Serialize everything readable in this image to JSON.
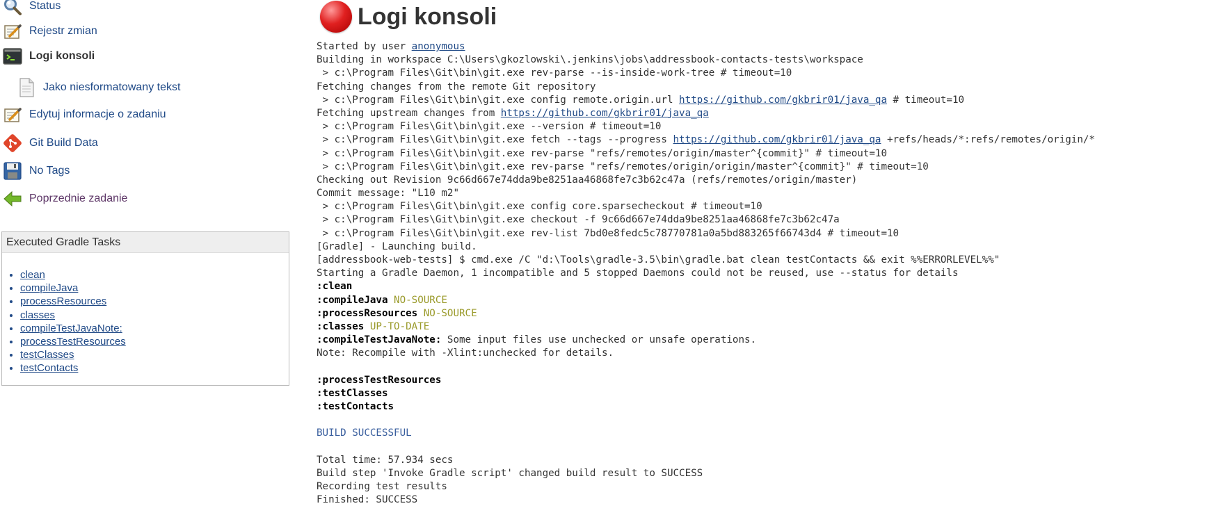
{
  "sidebar": {
    "items": [
      {
        "label": "Status",
        "icon": "magnifier-icon"
      },
      {
        "label": "Rejestr zmian",
        "icon": "notepad-icon"
      },
      {
        "label": "Logi konsoli",
        "icon": "terminal-icon"
      },
      {
        "label": "Jako niesformatowany tekst",
        "icon": "document-icon"
      },
      {
        "label": "Edytuj informacje o zadaniu",
        "icon": "notepad-icon"
      },
      {
        "label": "Git Build Data",
        "icon": "git-icon"
      },
      {
        "label": "No Tags",
        "icon": "floppy-disk-icon"
      },
      {
        "label": "Poprzednie zadanie",
        "icon": "green-arrow-left-icon"
      }
    ]
  },
  "gradle_tasks": {
    "title": "Executed Gradle Tasks",
    "items": [
      "clean",
      "compileJava",
      "processResources",
      "classes",
      "compileTestJavaNote:",
      "processTestResources",
      "testClasses",
      "testContacts"
    ]
  },
  "page": {
    "title": "Logi konsoli",
    "status_color": "#e02020"
  },
  "console": {
    "lines": [
      {
        "parts": [
          {
            "t": "Started by user "
          },
          {
            "t": "anonymous",
            "link": true
          }
        ]
      },
      {
        "parts": [
          {
            "t": "Building in workspace C:\\Users\\gkozlowski\\.jenkins\\jobs\\addressbook-contacts-tests\\workspace"
          }
        ]
      },
      {
        "parts": [
          {
            "t": " > c:\\Program Files\\Git\\bin\\git.exe rev-parse --is-inside-work-tree # timeout=10"
          }
        ]
      },
      {
        "parts": [
          {
            "t": "Fetching changes from the remote Git repository"
          }
        ]
      },
      {
        "parts": [
          {
            "t": " > c:\\Program Files\\Git\\bin\\git.exe config remote.origin.url "
          },
          {
            "t": "https://github.com/gkbrir01/java_qa",
            "link": true
          },
          {
            "t": " # timeout=10"
          }
        ]
      },
      {
        "parts": [
          {
            "t": "Fetching upstream changes from "
          },
          {
            "t": "https://github.com/gkbrir01/java_qa",
            "link": true
          }
        ]
      },
      {
        "parts": [
          {
            "t": " > c:\\Program Files\\Git\\bin\\git.exe --version # timeout=10"
          }
        ]
      },
      {
        "parts": [
          {
            "t": " > c:\\Program Files\\Git\\bin\\git.exe fetch --tags --progress "
          },
          {
            "t": "https://github.com/gkbrir01/java_qa",
            "link": true
          },
          {
            "t": " +refs/heads/*:refs/remotes/origin/*"
          }
        ]
      },
      {
        "parts": [
          {
            "t": " > c:\\Program Files\\Git\\bin\\git.exe rev-parse \"refs/remotes/origin/master^{commit}\" # timeout=10"
          }
        ]
      },
      {
        "parts": [
          {
            "t": " > c:\\Program Files\\Git\\bin\\git.exe rev-parse \"refs/remotes/origin/origin/master^{commit}\" # timeout=10"
          }
        ]
      },
      {
        "parts": [
          {
            "t": "Checking out Revision 9c66d667e74dda9be8251aa46868fe7c3b62c47a (refs/remotes/origin/master)"
          }
        ]
      },
      {
        "parts": [
          {
            "t": "Commit message: \"L10 m2\""
          }
        ]
      },
      {
        "parts": [
          {
            "t": " > c:\\Program Files\\Git\\bin\\git.exe config core.sparsecheckout # timeout=10"
          }
        ]
      },
      {
        "parts": [
          {
            "t": " > c:\\Program Files\\Git\\bin\\git.exe checkout -f 9c66d667e74dda9be8251aa46868fe7c3b62c47a"
          }
        ]
      },
      {
        "parts": [
          {
            "t": " > c:\\Program Files\\Git\\bin\\git.exe rev-list 7bd0e8fedc5c78770781a0a5bd883265f66743d4 # timeout=10"
          }
        ]
      },
      {
        "parts": [
          {
            "t": "[Gradle] - Launching build."
          }
        ]
      },
      {
        "parts": [
          {
            "t": "[addressbook-web-tests] $ cmd.exe /C \"d:\\Tools\\gradle-3.5\\bin\\gradle.bat clean testContacts && exit %%ERRORLEVEL%%\""
          }
        ]
      },
      {
        "parts": [
          {
            "t": "Starting a Gradle Daemon, 1 incompatible and 5 stopped Daemons could not be reused, use --status for details"
          }
        ]
      },
      {
        "parts": [
          {
            "t": ":clean",
            "bold": true
          }
        ]
      },
      {
        "parts": [
          {
            "t": ":compileJava",
            "bold": true
          },
          {
            "t": " "
          },
          {
            "t": "NO-SOURCE",
            "yellow": true
          }
        ]
      },
      {
        "parts": [
          {
            "t": ":processResources",
            "bold": true
          },
          {
            "t": " "
          },
          {
            "t": "NO-SOURCE",
            "yellow": true
          }
        ]
      },
      {
        "parts": [
          {
            "t": ":classes",
            "bold": true
          },
          {
            "t": " "
          },
          {
            "t": "UP-TO-DATE",
            "yellow": true
          }
        ]
      },
      {
        "parts": [
          {
            "t": ":compileTestJavaNote:",
            "bold": true
          },
          {
            "t": " Some input files use unchecked or unsafe operations."
          }
        ]
      },
      {
        "parts": [
          {
            "t": "Note: Recompile with -Xlint:unchecked for details."
          }
        ]
      },
      {
        "parts": [
          {
            "t": ""
          }
        ]
      },
      {
        "parts": [
          {
            "t": ":processTestResources",
            "bold": true
          }
        ]
      },
      {
        "parts": [
          {
            "t": ":testClasses",
            "bold": true
          }
        ]
      },
      {
        "parts": [
          {
            "t": ":testContacts",
            "bold": true
          }
        ]
      },
      {
        "parts": [
          {
            "t": ""
          }
        ]
      },
      {
        "parts": [
          {
            "t": "BUILD SUCCESSFUL",
            "blue": true
          }
        ]
      },
      {
        "parts": [
          {
            "t": ""
          }
        ]
      },
      {
        "parts": [
          {
            "t": "Total time: 57.934 secs"
          }
        ]
      },
      {
        "parts": [
          {
            "t": "Build step 'Invoke Gradle script' changed build result to SUCCESS"
          }
        ]
      },
      {
        "parts": [
          {
            "t": "Recording test results"
          }
        ]
      },
      {
        "parts": [
          {
            "t": "Finished: SUCCESS"
          }
        ]
      }
    ]
  }
}
